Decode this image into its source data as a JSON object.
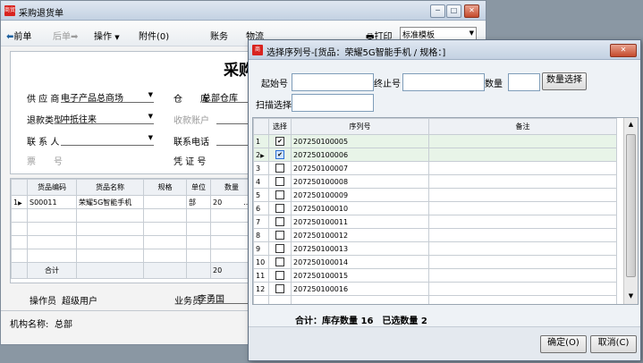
{
  "bg_window": {
    "title": "采购退货单",
    "app_icon": "商贸",
    "toolbar": {
      "prev": "前单",
      "next": "后单",
      "operations": "操作",
      "attachments": "附件(0)",
      "finance": "账务",
      "logistics": "物流",
      "print": "打印",
      "template": "标准模板"
    },
    "doc_title": "采购",
    "form": {
      "supplier_label": "供 应 商",
      "supplier_value": "电子产品总商场",
      "warehouse_label": "仓　　库",
      "warehouse_value": "总部仓库",
      "refund_type_label": "退款类型",
      "refund_type_value": "冲抵往来",
      "account_label": "收款账户",
      "contact_label": "联 系 人",
      "phone_label": "联系电话",
      "ticket_label": "票　　号",
      "voucher_label": "凭 证 号"
    },
    "grid": {
      "columns": [
        "货品编码",
        "货品名称",
        "规格",
        "单位",
        "数量"
      ],
      "row": {
        "num": "1",
        "code": "S00011",
        "name": "荣耀5G智能手机",
        "spec": "",
        "unit": "部",
        "qty": "20",
        "btn": "…"
      },
      "total_label": "合计",
      "total_qty": "20"
    },
    "footer": {
      "operator_label": "操作员",
      "operator_value": "超级用户",
      "salesman_label": "业务员",
      "salesman_value": "李勇国",
      "org_label": "机构名称:",
      "org_value": "总部"
    }
  },
  "dialog": {
    "title": "选择序列号-[货品：荣耀5G智能手机 / 规格：]",
    "start_label": "起始号",
    "end_label": "终止号",
    "qty_label": "数量",
    "qty_select_button": "数量选择",
    "scan_label": "扫描选择",
    "table": {
      "col_select": "选择",
      "col_serial": "序列号",
      "col_note": "备注",
      "rows": [
        {
          "num": "1",
          "checked": true,
          "serial": "207250100005"
        },
        {
          "num": "2",
          "checked": true,
          "serial": "207250100006"
        },
        {
          "num": "3",
          "checked": false,
          "serial": "207250100007"
        },
        {
          "num": "4",
          "checked": false,
          "serial": "207250100008"
        },
        {
          "num": "5",
          "checked": false,
          "serial": "207250100009"
        },
        {
          "num": "6",
          "checked": false,
          "serial": "207250100010"
        },
        {
          "num": "7",
          "checked": false,
          "serial": "207250100011"
        },
        {
          "num": "8",
          "checked": false,
          "serial": "207250100012"
        },
        {
          "num": "9",
          "checked": false,
          "serial": "207250100013"
        },
        {
          "num": "10",
          "checked": false,
          "serial": "207250100014"
        },
        {
          "num": "11",
          "checked": false,
          "serial": "207250100015"
        },
        {
          "num": "12",
          "checked": false,
          "serial": "207250100016"
        }
      ]
    },
    "summary": "合计：库存数量 16　已选数量 2",
    "ok_button": "确定(O)",
    "cancel_button": "取消(C)",
    "check_mark": "✔"
  },
  "colors": {
    "titlebar": "#c3d1e2",
    "grid_border": "#c7cdd4",
    "selected_row": "#e8f4e8"
  }
}
